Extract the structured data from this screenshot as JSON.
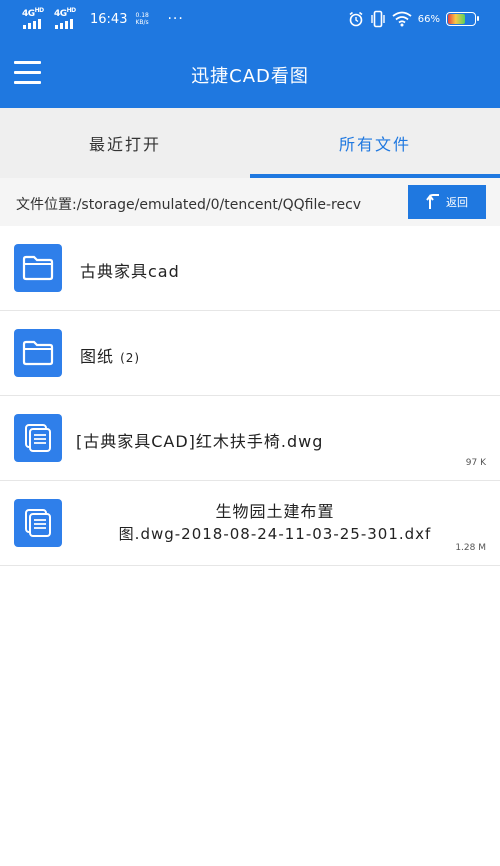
{
  "status_bar": {
    "network1": "4G",
    "network1_sup": "HD",
    "network2": "4G",
    "network2_sup": "HD",
    "time": "16:43",
    "speed_value": "0.18",
    "speed_unit": "KB/s",
    "more": "···",
    "battery_percent": "66%",
    "battery_level": 0.66,
    "icons": [
      "signal-icon",
      "alarm-icon",
      "vibrate-icon",
      "wifi-icon",
      "battery-icon"
    ]
  },
  "app_bar": {
    "title": "迅捷CAD看图",
    "menu_icon": "menu-icon"
  },
  "tabs": [
    {
      "label": "最近打开",
      "active": false
    },
    {
      "label": "所有文件",
      "active": true
    }
  ],
  "path_bar": {
    "path": "文件位置:/storage/emulated/0/tencent/QQfile-recv",
    "back_label": "返回"
  },
  "files": [
    {
      "type": "folder",
      "name": "古典家具cad",
      "size": ""
    },
    {
      "type": "folder",
      "name": "图纸",
      "count": "(2)",
      "size": ""
    },
    {
      "type": "file",
      "name": "[古典家具CAD]红木扶手椅.dwg",
      "size": "97 K"
    },
    {
      "type": "file",
      "name_line1": "生物园土建布置",
      "name_line2": "图.dwg-2018-08-24-11-03-25-301.dxf",
      "size": "1.28 M"
    }
  ],
  "colors": {
    "primary": "#1f78e0",
    "tab_background": "#efefef",
    "path_background": "#f5f5f5",
    "icon_blue": "#2f7fea"
  }
}
